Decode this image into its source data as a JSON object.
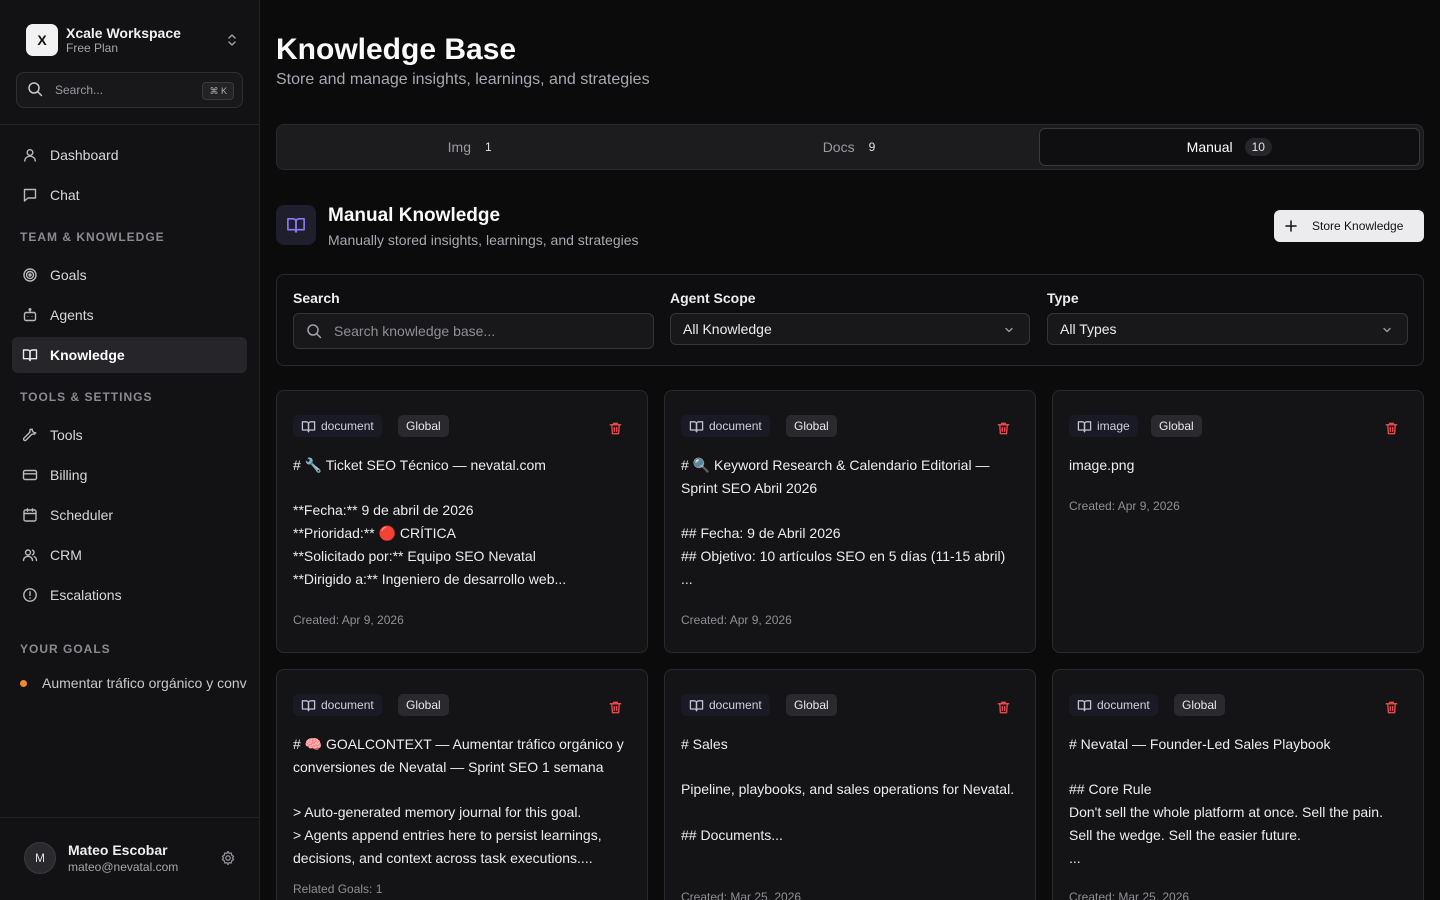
{
  "workspace": {
    "logo": "X",
    "name": "Xcale Workspace",
    "plan": "Free Plan"
  },
  "sidebar_search": {
    "placeholder": "Search...",
    "shortcut": "⌘ K"
  },
  "nav": {
    "dashboard": "Dashboard",
    "chat": "Chat",
    "section_team": "TEAM & KNOWLEDGE",
    "goals": "Goals",
    "agents": "Agents",
    "knowledge": "Knowledge",
    "section_tools": "TOOLS & SETTINGS",
    "tools": "Tools",
    "billing": "Billing",
    "scheduler": "Scheduler",
    "crm": "CRM",
    "escalations": "Escalations",
    "section_goals": "YOUR GOALS",
    "goal_1": "Aumentar tráfico orgánico y conversiones de Nevatal"
  },
  "user": {
    "initial": "M",
    "name": "Mateo Escobar",
    "email": "mateo@nevatal.com"
  },
  "page": {
    "title": "Knowledge Base",
    "subtitle": "Store and manage insights, learnings, and strategies"
  },
  "tabs": [
    {
      "label": "Img",
      "count": "1"
    },
    {
      "label": "Docs",
      "count": "9"
    },
    {
      "label": "Manual",
      "count": "10"
    }
  ],
  "section": {
    "title": "Manual Knowledge",
    "subtitle": "Manually stored insights, learnings, and strategies",
    "store_button": "Store Knowledge"
  },
  "filters": {
    "search_label": "Search",
    "search_placeholder": "Search knowledge base...",
    "scope_label": "Agent Scope",
    "scope_value": "All Knowledge",
    "type_label": "Type",
    "type_value": "All Types"
  },
  "cards": [
    {
      "type": "document",
      "scope": "Global",
      "content": "# 🔧 Ticket SEO Técnico — nevatal.com\n\n**Fecha:** 9 de abril de 2026\n**Prioridad:** 🔴 CRÍTICA\n**Solicitado por:** Equipo SEO Nevatal\n**Dirigido a:** Ingeniero de desarrollo web...",
      "meta": "Created: Apr 9, 2026"
    },
    {
      "type": "document",
      "scope": "Global",
      "content": "# 🔍 Keyword Research & Calendario Editorial — Sprint SEO Abril 2026\n\n## Fecha: 9 de Abril 2026\n## Objetivo: 10 artículos SEO en 5 días (11-15 abril)\n...",
      "meta": "Created: Apr 9, 2026"
    },
    {
      "type": "image",
      "scope": "Global",
      "content": "image.png",
      "meta": "Created: Apr 9, 2026"
    },
    {
      "type": "document",
      "scope": "Global",
      "content": "# 🧠 GOALCONTEXT — Aumentar tráfico orgánico y conversiones de Nevatal — Sprint SEO 1 semana\n\n> Auto-generated memory journal for this goal.\n> Agents append entries here to persist learnings, decisions, and context across task executions....",
      "meta": "Related Goals: 1"
    },
    {
      "type": "document",
      "scope": "Global",
      "content": "# Sales\n\nPipeline, playbooks, and sales operations for Nevatal.\n\n## Documents...",
      "meta": "Created: Mar 25, 2026"
    },
    {
      "type": "document",
      "scope": "Global",
      "content": "# Nevatal — Founder-Led Sales Playbook\n\n## Core Rule\nDon't sell the whole platform at once. Sell the pain. Sell the wedge. Sell the easier future.\n...",
      "meta": "Created: Mar 25, 2026"
    }
  ],
  "icons": {
    "workspace_switch": "chevrons-up-down-icon",
    "search": "search-icon",
    "dashboard": "user-icon",
    "chat": "message-square-icon",
    "goals": "target-icon",
    "agents": "bot-icon",
    "knowledge": "book-open-icon",
    "tools": "wrench-icon",
    "billing": "credit-card-icon",
    "scheduler": "calendar-icon",
    "crm": "users-icon",
    "escalations": "alert-circle-icon",
    "settings": "gear-icon",
    "add": "plus-icon",
    "chevron": "chevron-down-icon",
    "delete": "trash-icon"
  },
  "colors": {
    "background": "#0b0b0c",
    "sidebar": "#121214",
    "accent": "#8b7cf6",
    "goal_dot": "#f08a24",
    "danger": "#e5484d"
  }
}
